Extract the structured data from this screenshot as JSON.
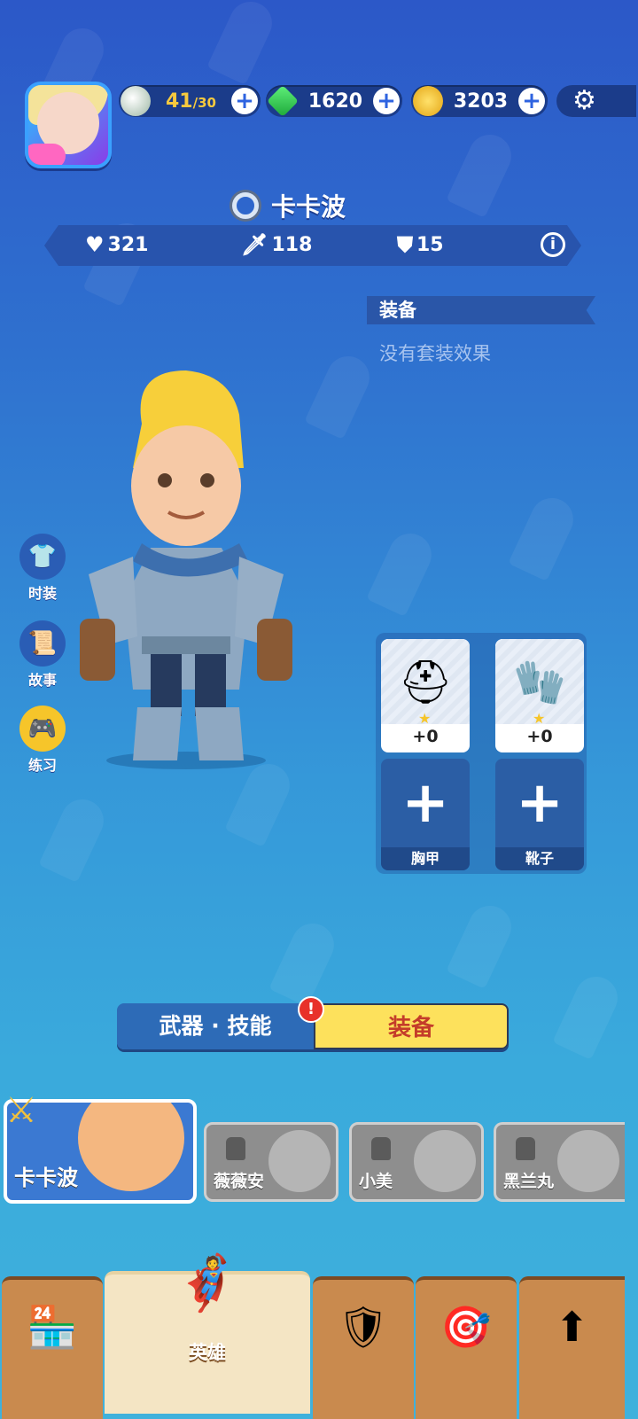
{
  "top_bar": {
    "energy": {
      "value": "41",
      "max": "/30",
      "icon": "energy-egg-icon"
    },
    "gems": {
      "value": "1620",
      "icon": "green-gem-icon"
    },
    "coins": {
      "value": "3203",
      "icon": "gold-coin-icon"
    },
    "settings_icon": "gear-icon"
  },
  "hero": {
    "name": "卡卡波",
    "stats": {
      "health": "321",
      "attack": "118",
      "defense": "15"
    }
  },
  "equipment_panel": {
    "header": "装备",
    "set_effect": "没有套装效果",
    "slots": [
      {
        "type": "helmet",
        "level": "+0",
        "filled": true
      },
      {
        "type": "gloves",
        "level": "+0",
        "filled": true
      },
      {
        "label": "胸甲",
        "filled": false
      },
      {
        "label": "靴子",
        "filled": false
      }
    ]
  },
  "side_menu": [
    {
      "label": "时装",
      "icon": "shirt-icon"
    },
    {
      "label": "故事",
      "icon": "scroll-icon"
    },
    {
      "label": "练习",
      "icon": "gamepad-icon"
    }
  ],
  "tabs": {
    "weapon_skill": "武器 · 技能",
    "equipment": "装备"
  },
  "hero_list": [
    {
      "name": "卡卡波",
      "selected": true
    },
    {
      "name": "薇薇安",
      "locked": true
    },
    {
      "name": "小美",
      "locked": true
    },
    {
      "name": "黑兰丸",
      "locked": true
    }
  ],
  "bottom_nav": [
    {
      "icon": "shop-icon",
      "label": ""
    },
    {
      "icon": "hero-icon",
      "label": "英雄",
      "active": true
    },
    {
      "icon": "battle-shield-icon",
      "label": ""
    },
    {
      "icon": "target-icon",
      "label": ""
    },
    {
      "icon": "upgrade-arrow-icon",
      "label": ""
    }
  ]
}
